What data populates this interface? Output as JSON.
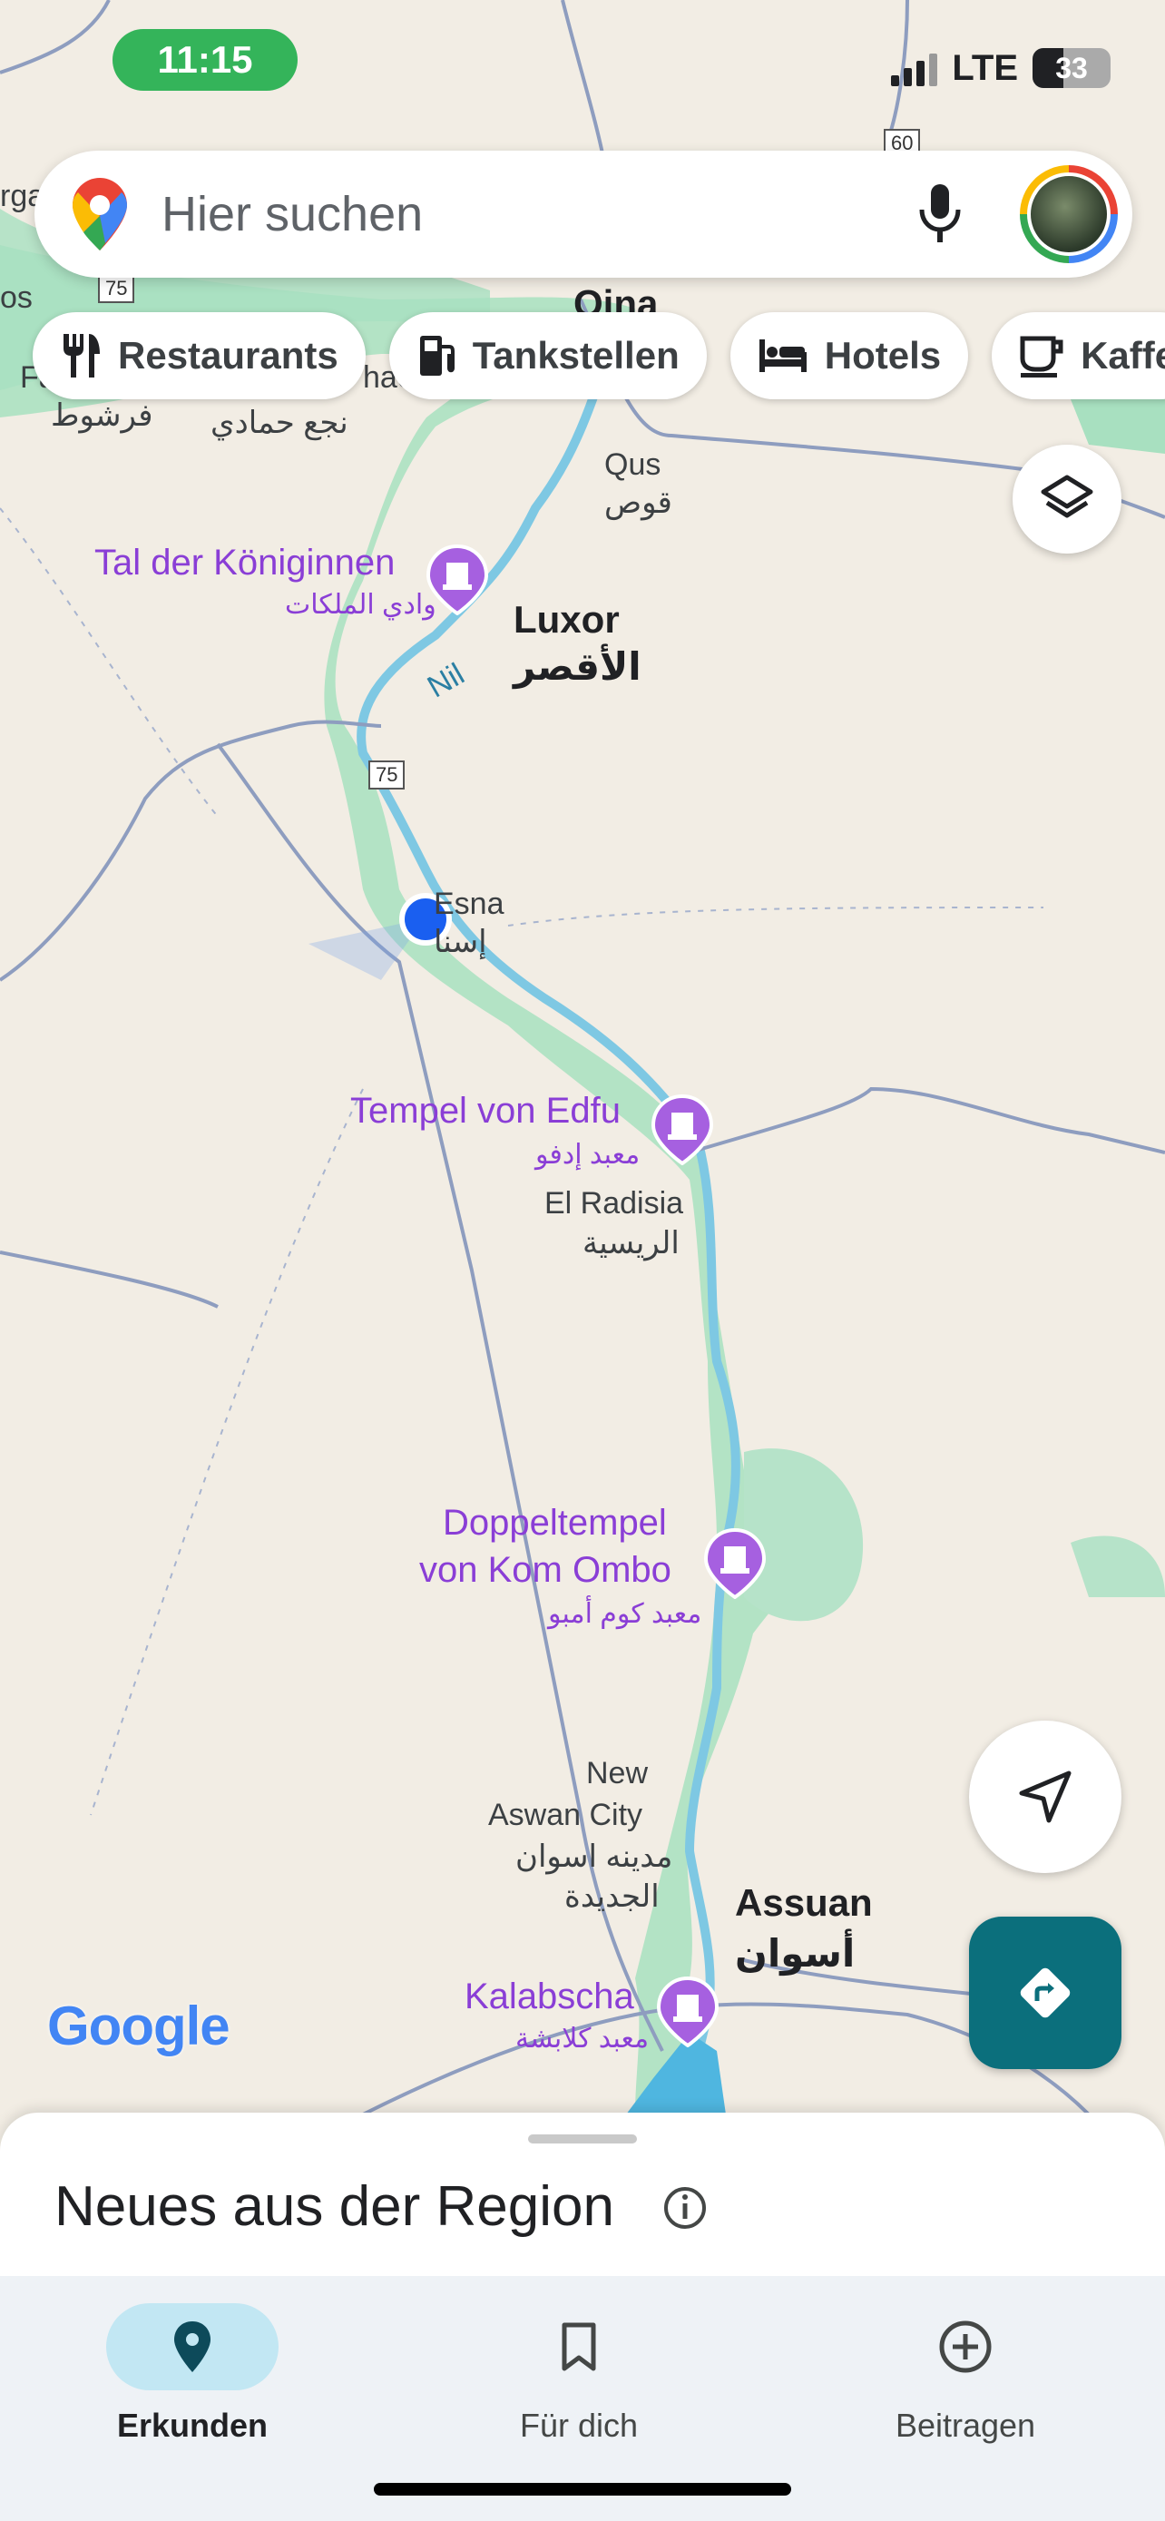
{
  "status_bar": {
    "time": "11:15",
    "network": "LTE",
    "battery": "33"
  },
  "search": {
    "placeholder": "Hier suchen"
  },
  "chips": [
    {
      "label": "Restaurants",
      "icon": "fork-knife-icon"
    },
    {
      "label": "Tankstellen",
      "icon": "gas-station-icon"
    },
    {
      "label": "Hotels",
      "icon": "bed-icon"
    },
    {
      "label": "Kaffe",
      "icon": "coffee-cup-icon"
    }
  ],
  "map": {
    "places": {
      "qina": "Qina",
      "qus": "Qus",
      "qus_ar": "قوص",
      "luxor": "Luxor",
      "luxor_ar": "الأقصر",
      "nil": "Nil",
      "esna": "Esna",
      "esna_ar": "إسنا",
      "el_radisia": "El Radisia",
      "el_radisia_ar": "الريسية",
      "new_aswan_1": "New",
      "new_aswan_2": "Aswan City",
      "new_aswan_ar1": "مدينه اسوان",
      "new_aswan_ar2": "الجديدة",
      "assuan": "Assuan",
      "assuan_ar": "أسوان",
      "farshut_ar": "فرشوط",
      "nag_hammadi_ar": "نجع حمادي",
      "edge_rga": "rga",
      "edge_os": "os",
      "edge_fa": "Fa",
      "edge_hac": "hac"
    },
    "pois": {
      "tal": "Tal der Königinnen",
      "tal_ar": "وادي الملكات",
      "edfu": "Tempel von Edfu",
      "edfu_ar": "معبد إدفو",
      "kom_ombo_1": "Doppeltempel",
      "kom_ombo_2": "von Kom Ombo",
      "kom_ombo_ar": "معبد كوم أمبو",
      "kalabscha": "Kalabscha",
      "kalabscha_ar": "معبد كلابشة"
    },
    "roads": {
      "r60": "60",
      "r75a": "75",
      "r75b": "75"
    },
    "watermark": "Google"
  },
  "sheet": {
    "title": "Neues aus der Region"
  },
  "nav": [
    {
      "label": "Erkunden",
      "icon": "explore-pin-icon",
      "active": true
    },
    {
      "label": "Für dich",
      "icon": "bookmark-icon",
      "active": false
    },
    {
      "label": "Beitragen",
      "icon": "add-circle-icon",
      "active": false
    }
  ],
  "colors": {
    "poi": "#8a3ed6",
    "river": "#7ec8e3",
    "green": "#a8e0c0",
    "accent": "#0b6f7c"
  }
}
